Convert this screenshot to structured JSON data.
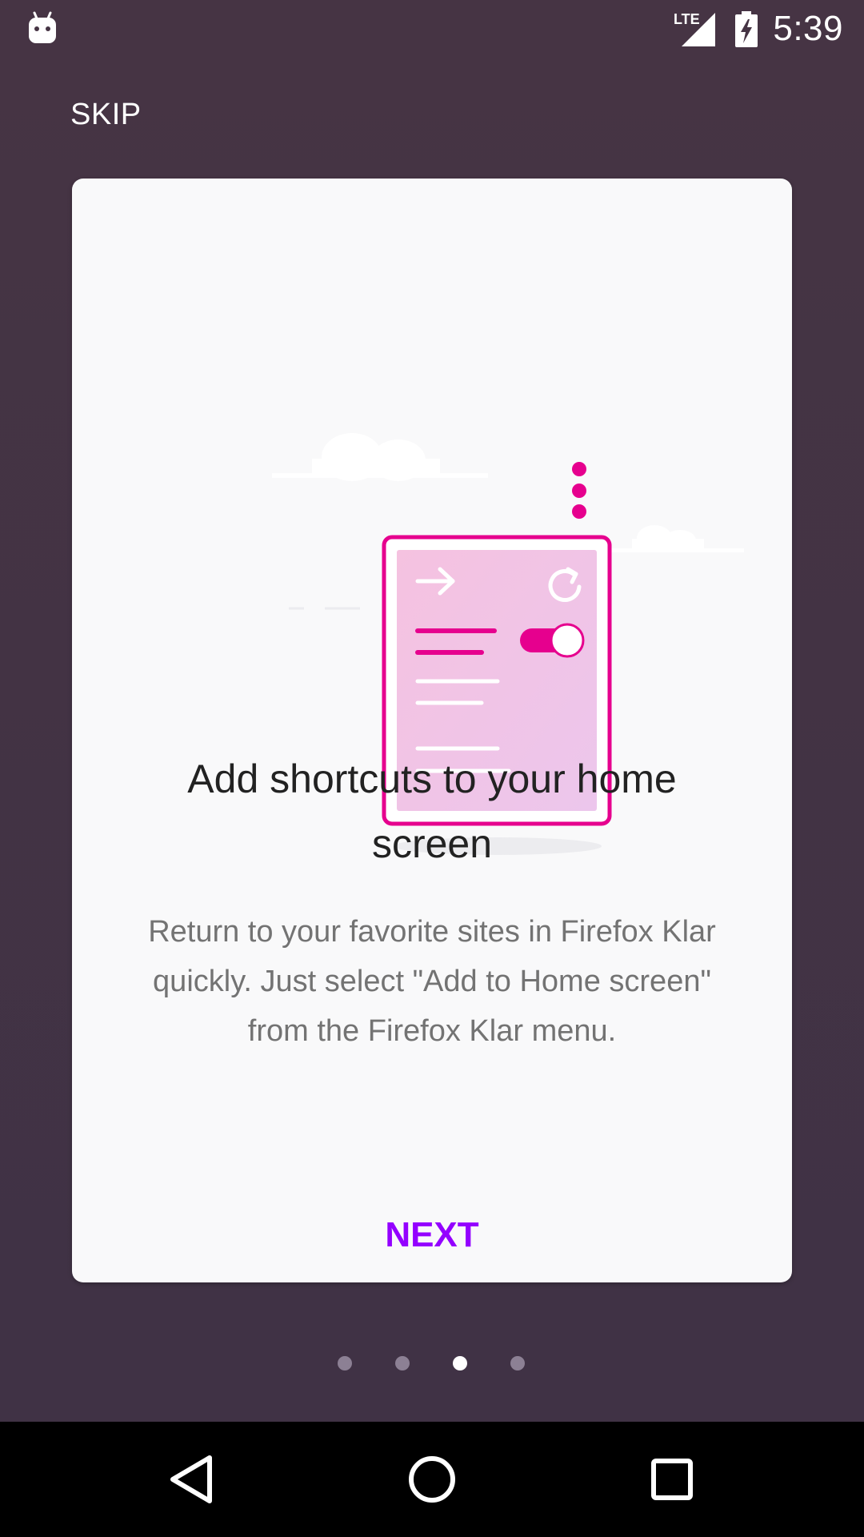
{
  "status_bar": {
    "left_icon": "android-debug-icon",
    "network": "LTE",
    "signal_icon": "cell-signal-icon",
    "battery_icon": "battery-charging-icon",
    "time": "5:39"
  },
  "onboarding": {
    "skip_label": "SKIP",
    "illustration_icon": "add-to-home-screen-illustration",
    "title": "Add shortcuts to your home screen",
    "body": "Return to your favorite sites in Firefox Klar quickly. Just select \"Add to Home screen\" from the Firefox Klar menu.",
    "next_label": "NEXT",
    "accent_color": "#9400ff",
    "illustration_color": "#e6008e"
  },
  "pager": {
    "page_count": 4,
    "current_page": 3
  },
  "nav_bar": {
    "back_icon": "back-triangle-icon",
    "home_icon": "home-circle-icon",
    "recents_icon": "recents-square-icon"
  }
}
